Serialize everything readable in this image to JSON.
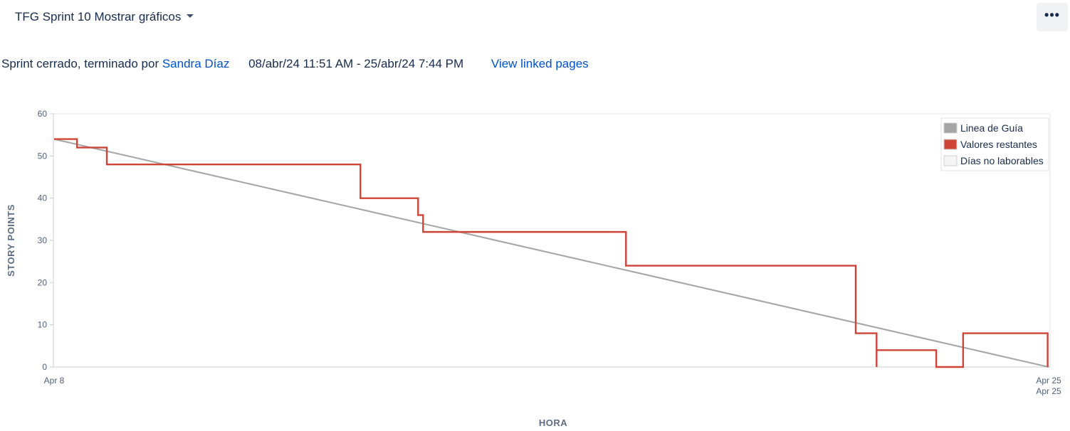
{
  "header": {
    "board_title": "TFG Sprint 10 Mostrar gráficos",
    "dropdown_icon": "chevron-down-icon",
    "more_label": "•••",
    "more_icon": "more-horizontal-icon"
  },
  "sprint_info": {
    "status_prefix": "Sprint cerrado, terminado por",
    "finished_by": "Sandra Díaz",
    "date_range": "08/abr/24 11:51 AM - 25/abr/24 7:44 PM",
    "linked_pages": "View linked pages"
  },
  "colors": {
    "guideline": "#a5a5a5",
    "remaining": "#d04437",
    "non_working": "#f5f5f5",
    "link": "#0052cc"
  },
  "chart_data": {
    "type": "line",
    "xlabel": "HORA",
    "ylabel": "STORY POINTS",
    "ylim": [
      0,
      60
    ],
    "yticks": [
      "0",
      "10",
      "20",
      "30",
      "40",
      "50",
      "60"
    ],
    "x_start_label": "Apr 8",
    "x_end_label": "Apr 25",
    "x_end_sublabel": "Apr 25",
    "grid": false,
    "legend_position": "top-right",
    "legend": [
      {
        "label": "Linea de Guía",
        "color": "#a5a5a5"
      },
      {
        "label": "Valores restantes",
        "color": "#d04437"
      },
      {
        "label": "Días no laborables",
        "color": "#f5f5f5"
      }
    ],
    "series": [
      {
        "name": "Linea de Guía",
        "style": "line",
        "points": [
          [
            0,
            54
          ],
          [
            1,
            0
          ]
        ]
      },
      {
        "name": "Valores restantes",
        "style": "step",
        "points": [
          [
            0,
            54
          ],
          [
            0.023,
            54
          ],
          [
            0.023,
            52
          ],
          [
            0.053,
            52
          ],
          [
            0.053,
            48
          ],
          [
            0.308,
            48
          ],
          [
            0.308,
            40
          ],
          [
            0.366,
            40
          ],
          [
            0.366,
            36
          ],
          [
            0.371,
            36
          ],
          [
            0.371,
            32
          ],
          [
            0.575,
            32
          ],
          [
            0.575,
            24
          ],
          [
            0.806,
            24
          ],
          [
            0.806,
            8
          ],
          [
            0.827,
            8
          ],
          [
            0.827,
            0
          ],
          [
            0.827,
            4
          ],
          [
            0.887,
            4
          ],
          [
            0.887,
            0
          ],
          [
            0.914,
            0
          ],
          [
            0.914,
            8
          ],
          [
            0.999,
            8
          ],
          [
            0.999,
            0
          ]
        ]
      }
    ]
  }
}
